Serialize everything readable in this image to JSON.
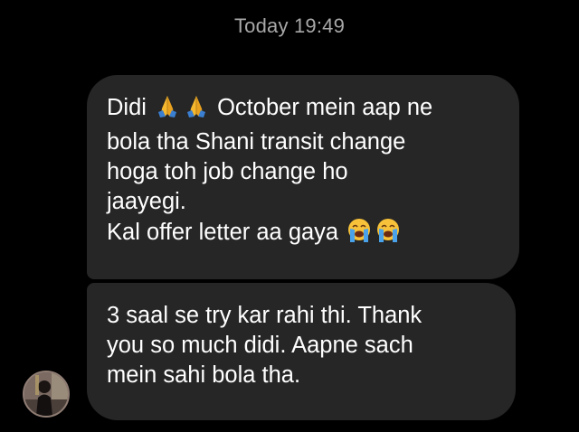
{
  "header": {
    "timestamp": "Today 19:49"
  },
  "messages": [
    {
      "lines": [
        {
          "parts": [
            {
              "type": "text",
              "value": "Didi "
            },
            {
              "type": "emoji",
              "icon": "folded-hands-icon"
            },
            {
              "type": "emoji",
              "icon": "folded-hands-icon"
            },
            {
              "type": "text",
              "value": " October mein aap ne"
            }
          ]
        },
        {
          "parts": [
            {
              "type": "text",
              "value": "bola tha Shani transit change"
            }
          ]
        },
        {
          "parts": [
            {
              "type": "text",
              "value": "hoga toh job change ho"
            }
          ]
        },
        {
          "parts": [
            {
              "type": "text",
              "value": "jaayegi."
            }
          ]
        },
        {
          "parts": [
            {
              "type": "text",
              "value": "Kal offer letter aa gaya "
            },
            {
              "type": "emoji",
              "icon": "loudly-crying-face-icon"
            },
            {
              "type": "emoji",
              "icon": "loudly-crying-face-icon"
            }
          ]
        }
      ]
    },
    {
      "lines": [
        {
          "parts": [
            {
              "type": "text",
              "value": "3 saal se try kar rahi thi. Thank"
            }
          ]
        },
        {
          "parts": [
            {
              "type": "text",
              "value": "you so much didi. Aapne sach"
            }
          ]
        },
        {
          "parts": [
            {
              "type": "text",
              "value": "mein sahi bola tha."
            }
          ]
        }
      ]
    }
  ],
  "colors": {
    "background": "#000000",
    "bubble": "#262626",
    "message_text": "#ffffff",
    "timestamp_text": "#a8a8a8"
  }
}
